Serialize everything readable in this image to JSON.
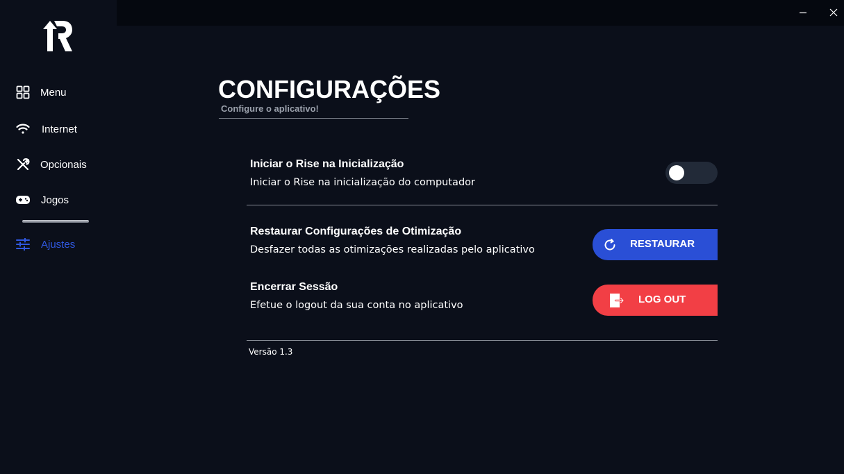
{
  "window": {
    "minimize_icon": "minimize-icon",
    "close_icon": "close-icon"
  },
  "sidebar": {
    "items": [
      {
        "label": "Menu",
        "icon": "grid-icon"
      },
      {
        "label": "Internet",
        "icon": "wifi-icon"
      },
      {
        "label": "Opcionais",
        "icon": "tools-icon"
      },
      {
        "label": "Jogos",
        "icon": "gamepad-icon"
      },
      {
        "label": "Ajustes",
        "icon": "sliders-icon",
        "active": true
      }
    ]
  },
  "page": {
    "title": "CONFIGURAÇÕES",
    "subtitle": "Configure o aplicativo!"
  },
  "settings": {
    "startup": {
      "title": "Iniciar o Rise na Inicialização",
      "description": "Iniciar o Rise na inicialização do computador",
      "enabled": false
    },
    "restore": {
      "title": "Restaurar Configurações de Otimização",
      "description": "Desfazer todas as otimizações realizadas pelo aplicativo",
      "button_label": "RESTAURAR"
    },
    "logout": {
      "title": "Encerrar Sessão",
      "description": "Efetue o logout da sua conta no aplicativo",
      "button_label": "LOG OUT"
    }
  },
  "version": "Versão 1.3",
  "colors": {
    "background": "#0b0f1a",
    "accent": "#3058e0",
    "restore_button": "#2a4fd6",
    "logout_button": "#f23f45",
    "toggle_track": "#222a38"
  }
}
